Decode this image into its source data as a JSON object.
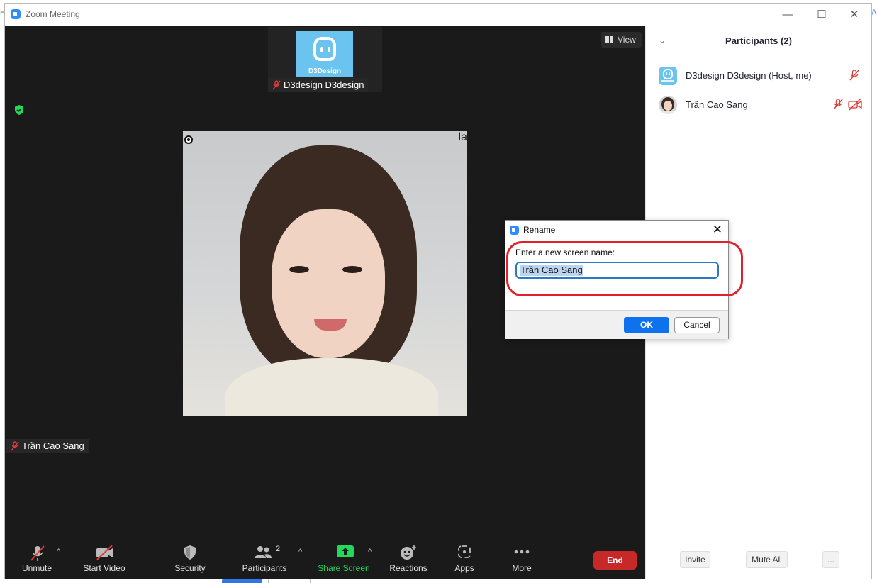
{
  "window": {
    "title": "Zoom Meeting",
    "minimize": "—",
    "maximize": "☐",
    "close": "✕"
  },
  "gallery": {
    "thumb_brand": "D3Design",
    "thumb_name": "D3design D3design",
    "main_name": "Trần Cao Sang",
    "corner_text": "la"
  },
  "view_button": {
    "label": "View"
  },
  "toolbar": {
    "unmute": "Unmute",
    "start_video": "Start Video",
    "security": "Security",
    "participants": "Participants",
    "participants_count": "2",
    "share_screen": "Share Screen",
    "reactions": "Reactions",
    "apps": "Apps",
    "more": "More",
    "end": "End",
    "caret": "^"
  },
  "panel": {
    "title": "Participants (2)",
    "participants": [
      {
        "name": "D3design D3design (Host, me)"
      },
      {
        "name": "Trần Cao Sang"
      }
    ],
    "invite": "Invite",
    "mute_all": "Mute All",
    "more": "..."
  },
  "dialog": {
    "title": "Rename",
    "prompt": "Enter a new screen name:",
    "value": "Trần Cao Sang",
    "ok": "OK",
    "cancel": "Cancel"
  },
  "edge": {
    "left": "H",
    "right": "A"
  },
  "colors": {
    "accent": "#0e72ed",
    "end_red": "#c72828",
    "share_green": "#23d959",
    "highlight_red": "#e0202a"
  }
}
